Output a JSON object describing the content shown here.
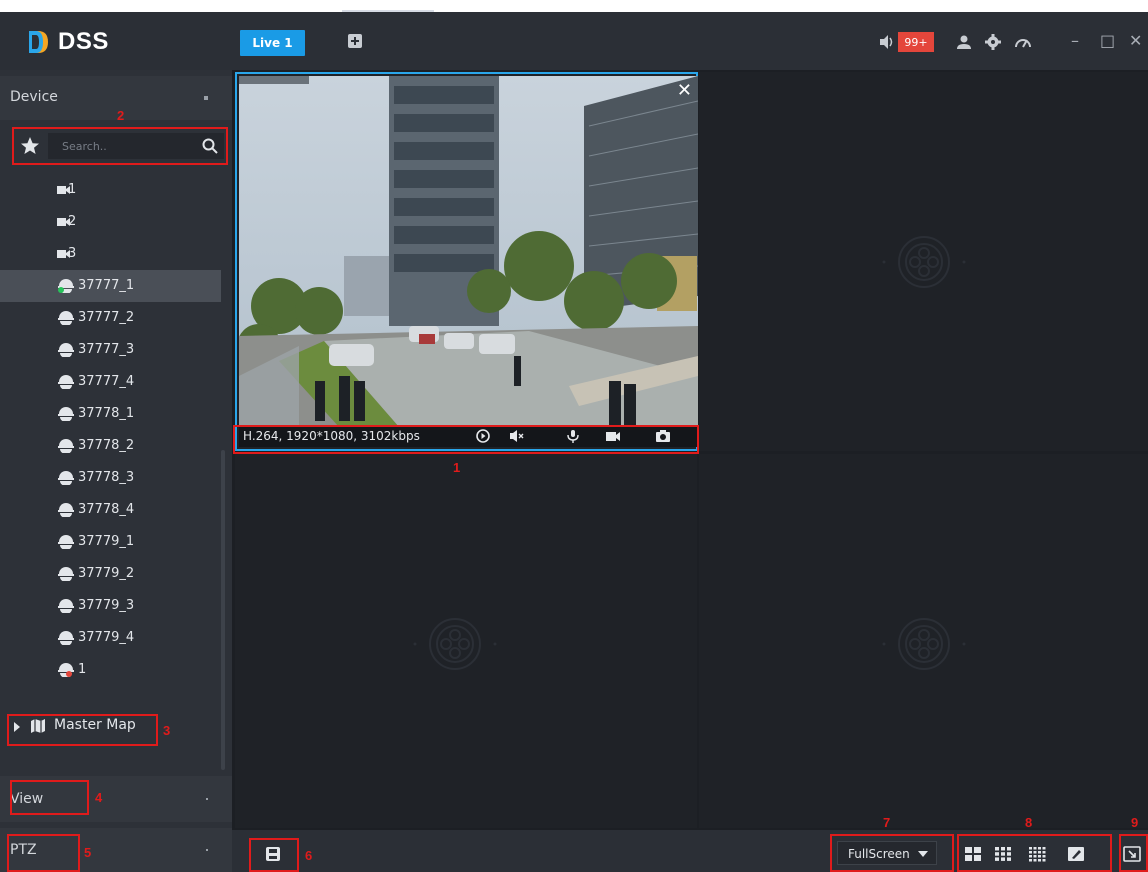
{
  "app": {
    "logo": "DSS"
  },
  "header": {
    "tab_live": "Live 1",
    "alarm_badge": "99+"
  },
  "sidebar": {
    "device_label": "Device",
    "search": {
      "placeholder": "Search.."
    },
    "tree": [
      {
        "label": "1",
        "type": "camera"
      },
      {
        "label": "2",
        "type": "camera"
      },
      {
        "label": "3",
        "type": "camera"
      },
      {
        "label": "37777_1",
        "type": "dome-online",
        "selected": true
      },
      {
        "label": "37777_2",
        "type": "dome"
      },
      {
        "label": "37777_3",
        "type": "dome"
      },
      {
        "label": "37777_4",
        "type": "dome"
      },
      {
        "label": "37778_1",
        "type": "dome"
      },
      {
        "label": "37778_2",
        "type": "dome"
      },
      {
        "label": "37778_3",
        "type": "dome"
      },
      {
        "label": "37778_4",
        "type": "dome"
      },
      {
        "label": "37779_1",
        "type": "dome"
      },
      {
        "label": "37779_2",
        "type": "dome"
      },
      {
        "label": "37779_3",
        "type": "dome"
      },
      {
        "label": "37779_4",
        "type": "dome"
      },
      {
        "label": "1",
        "type": "dome-alarm"
      }
    ],
    "master_map": "Master Map",
    "view_label": "View",
    "ptz_label": "PTZ"
  },
  "video": {
    "stream_info": "H.264, 1920*1080, 3102kbps"
  },
  "footer": {
    "fullscreen_select": "FullScreen"
  },
  "annotations": {
    "n1": "1",
    "n2": "2",
    "n3": "3",
    "n4": "4",
    "n5": "5",
    "n6": "6",
    "n7": "7",
    "n8": "8",
    "n9": "9"
  },
  "colors": {
    "accent": "#1a9be6",
    "active_border": "#2aa6ea",
    "badge": "#e4463b",
    "annotation": "#e01b1b",
    "online": "#27c35a"
  },
  "icons": {
    "speaker": "speaker-icon",
    "user": "user-icon",
    "settings": "gear-icon",
    "performance": "gauge-icon",
    "search": "search-icon",
    "favorite": "star-icon",
    "map": "map-icon",
    "play": "play-icon",
    "mute": "mute-icon",
    "talk": "microphone-icon",
    "record": "video-record-icon",
    "snapshot": "camera-icon",
    "save": "save-icon",
    "layout4": "layout-4-icon",
    "layout9": "layout-9-icon",
    "layout16": "layout-16-icon",
    "custom_layout": "custom-layout-icon",
    "fit": "fit-window-icon"
  }
}
